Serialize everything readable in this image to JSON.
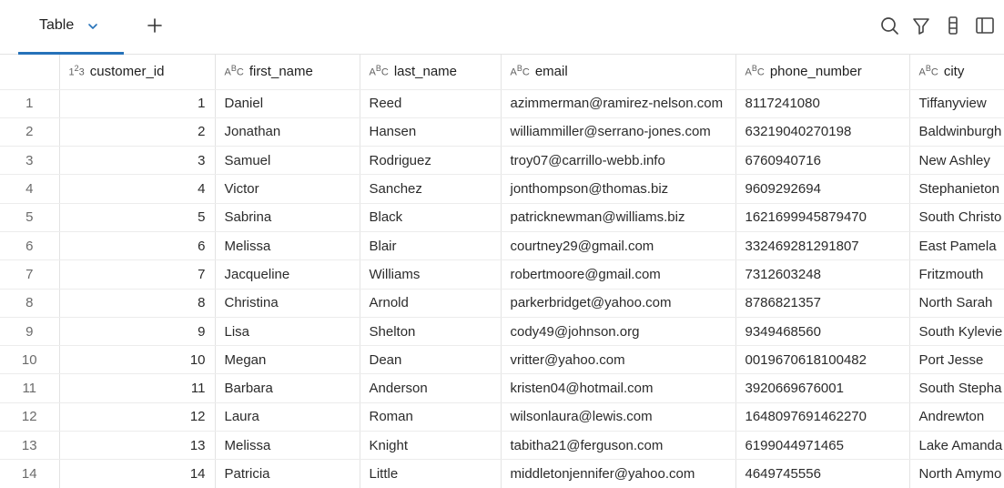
{
  "tab": {
    "label": "Table"
  },
  "toolbar_icons": [
    "search-icon",
    "filter-icon",
    "column-config-icon",
    "panel-toggle-icon"
  ],
  "columns": [
    {
      "name": "customer_id",
      "type": "integer"
    },
    {
      "name": "first_name",
      "type": "string"
    },
    {
      "name": "last_name",
      "type": "string"
    },
    {
      "name": "email",
      "type": "string"
    },
    {
      "name": "phone_number",
      "type": "string"
    },
    {
      "name": "city",
      "type": "string"
    }
  ],
  "rows": [
    {
      "n": "1",
      "customer_id": "1",
      "first_name": "Daniel",
      "last_name": "Reed",
      "email": "azimmerman@ramirez-nelson.com",
      "phone_number": "8117241080",
      "city": "Tiffanyview"
    },
    {
      "n": "2",
      "customer_id": "2",
      "first_name": "Jonathan",
      "last_name": "Hansen",
      "email": "williammiller@serrano-jones.com",
      "phone_number": "63219040270198",
      "city": "Baldwinburgh"
    },
    {
      "n": "3",
      "customer_id": "3",
      "first_name": "Samuel",
      "last_name": "Rodriguez",
      "email": "troy07@carrillo-webb.info",
      "phone_number": "6760940716",
      "city": "New Ashley"
    },
    {
      "n": "4",
      "customer_id": "4",
      "first_name": "Victor",
      "last_name": "Sanchez",
      "email": "jonthompson@thomas.biz",
      "phone_number": "9609292694",
      "city": "Stephanieton"
    },
    {
      "n": "5",
      "customer_id": "5",
      "first_name": "Sabrina",
      "last_name": "Black",
      "email": "patricknewman@williams.biz",
      "phone_number": "1621699945879470",
      "city": "South Christo"
    },
    {
      "n": "6",
      "customer_id": "6",
      "first_name": "Melissa",
      "last_name": "Blair",
      "email": "courtney29@gmail.com",
      "phone_number": "332469281291807",
      "city": "East Pamela"
    },
    {
      "n": "7",
      "customer_id": "7",
      "first_name": "Jacqueline",
      "last_name": "Williams",
      "email": "robertmoore@gmail.com",
      "phone_number": "7312603248",
      "city": "Fritzmouth"
    },
    {
      "n": "8",
      "customer_id": "8",
      "first_name": "Christina",
      "last_name": "Arnold",
      "email": "parkerbridget@yahoo.com",
      "phone_number": "8786821357",
      "city": "North Sarah"
    },
    {
      "n": "9",
      "customer_id": "9",
      "first_name": "Lisa",
      "last_name": "Shelton",
      "email": "cody49@johnson.org",
      "phone_number": "9349468560",
      "city": "South Kylevie"
    },
    {
      "n": "10",
      "customer_id": "10",
      "first_name": "Megan",
      "last_name": "Dean",
      "email": "vritter@yahoo.com",
      "phone_number": "0019670618100482",
      "city": "Port Jesse"
    },
    {
      "n": "11",
      "customer_id": "11",
      "first_name": "Barbara",
      "last_name": "Anderson",
      "email": "kristen04@hotmail.com",
      "phone_number": "3920669676001",
      "city": "South Stepha"
    },
    {
      "n": "12",
      "customer_id": "12",
      "first_name": "Laura",
      "last_name": "Roman",
      "email": "wilsonlaura@lewis.com",
      "phone_number": "1648097691462270",
      "city": "Andrewton"
    },
    {
      "n": "13",
      "customer_id": "13",
      "first_name": "Melissa",
      "last_name": "Knight",
      "email": "tabitha21@ferguson.com",
      "phone_number": "6199044971465",
      "city": "Lake Amanda"
    },
    {
      "n": "14",
      "customer_id": "14",
      "first_name": "Patricia",
      "last_name": "Little",
      "email": "middletonjennifer@yahoo.com",
      "phone_number": "4649745556",
      "city": "North Amymo"
    }
  ]
}
